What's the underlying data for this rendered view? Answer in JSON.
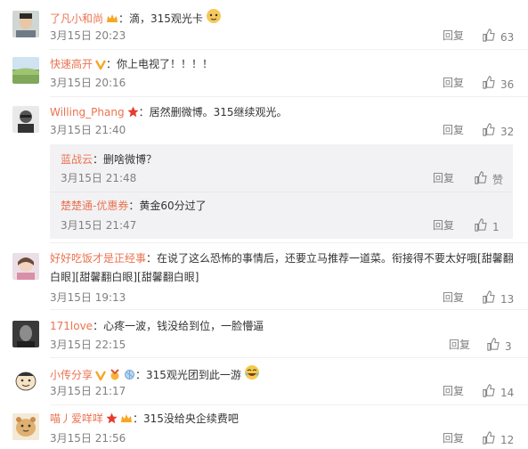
{
  "colors": {
    "username": "#eb7350",
    "meta": "#808080",
    "text": "#333333",
    "sub_bg": "#f2f2f5"
  },
  "reply_label": "回复",
  "comments": [
    {
      "user": "了凡小和尚",
      "sep": "：",
      "text": "滴，315观光卡",
      "time": "3月15日 20:23",
      "likes": "63",
      "badges": [
        "vip-crown-icon"
      ],
      "emoji": "dog-emoji-icon"
    },
    {
      "user": "快速高开",
      "sep": "：",
      "text": "你上电视了！！！！",
      "time": "3月15日 20:16",
      "likes": "36",
      "badges": [
        "verified-v-icon"
      ]
    },
    {
      "user": "Willing_Phang",
      "sep": "：",
      "text": "居然删微博。315继续观光。",
      "time": "3月15日 21:40",
      "likes": "32",
      "badges": [
        "star-icon"
      ]
    },
    {
      "user": "好好吃饭才是正经事",
      "sep": "：",
      "text": "在说了这么恐怖的事情后，还要立马推荐一道菜。衔接得不要太好哦[甜馨翻",
      "text2": "白眼][甜馨翻白眼][甜馨翻白眼]",
      "time": "3月15日 19:13",
      "likes": "13",
      "badges": []
    },
    {
      "user": "171love",
      "sep": "：",
      "text": "心疼一波，钱没给到位，一脸懵逼",
      "time": "3月15日 22:15",
      "likes": "3",
      "badges": []
    },
    {
      "user": "小传分享",
      "sep": "：",
      "text": "315观光团到此一游",
      "time": "3月15日 21:17",
      "likes": "14",
      "badges": [
        "verified-v-icon",
        "medal-icon",
        "shell-icon"
      ],
      "emoji": "laugh-emoji-icon"
    },
    {
      "user": "喵丿爱咩咩",
      "sep": "：",
      "text": "315没给央企续费吧",
      "time": "3月15日 21:56",
      "likes": "12",
      "badges": [
        "star-icon",
        "vip-crown-icon"
      ]
    }
  ],
  "subreplies": [
    {
      "user": "蓝战云",
      "sep": "：",
      "text": "删啥微博？",
      "time": "3月15日 21:48",
      "likes": "赞"
    },
    {
      "user": "楚楚通-优惠券",
      "sep": "：",
      "text": "黄金60分过了",
      "time": "3月15日 21:47",
      "likes": "1"
    }
  ]
}
